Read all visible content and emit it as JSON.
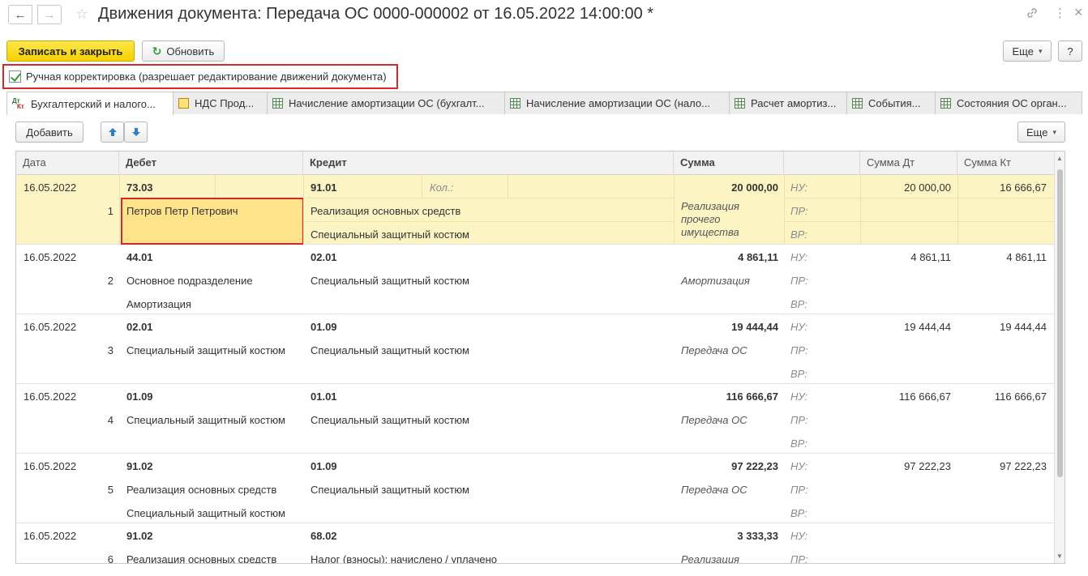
{
  "window": {
    "title": "Движения документа: Передача ОС 0000-000002 от 16.05.2022 14:00:00 *",
    "back_icon": "←",
    "forward_icon": "→",
    "star_icon": "☆",
    "link_icon": "🔗",
    "more_icon": "⋮",
    "close_icon": "×"
  },
  "toolbar": {
    "save_close_label": "Записать и закрыть",
    "refresh_label": "Обновить",
    "refresh_glyph": "↻",
    "more_label": "Еще",
    "help_label": "?"
  },
  "manual_edit": {
    "label": "Ручная корректировка (разрешает редактирование движений документа)",
    "checked": true
  },
  "tabs": [
    {
      "label": "Бухгалтерский и налого...",
      "icon": "dt-kt-icon",
      "active": true
    },
    {
      "label": "НДС Прод...",
      "icon": "nds-icon",
      "active": false
    },
    {
      "label": "Начисление амортизации ОС (бухгалт...",
      "icon": "grid-icon",
      "active": false
    },
    {
      "label": "Начисление амортизации ОС (нало...",
      "icon": "grid-icon",
      "active": false
    },
    {
      "label": "Расчет амортиз...",
      "icon": "grid-icon",
      "active": false
    },
    {
      "label": "События...",
      "icon": "grid-icon",
      "active": false
    },
    {
      "label": "Состояния ОС орган...",
      "icon": "grid-icon",
      "active": false
    }
  ],
  "dt_kt": {
    "dt": "Дт",
    "kt": "Кт"
  },
  "table_toolbar": {
    "add_label": "Добавить",
    "up_icon": "🡅",
    "down_icon": "🡇",
    "more_label": "Еще"
  },
  "columns": {
    "date": "Дата",
    "debit": "Дебет",
    "credit": "Кредит",
    "sum": "Сумма",
    "blank": "",
    "sum_dt": "Сумма Дт",
    "sum_kt": "Сумма Кт"
  },
  "labels": {
    "nu": "НУ:",
    "pr": "ПР:",
    "vr": "ВР:",
    "kol": "Кол.:"
  },
  "rows": [
    {
      "date": "16.05.2022",
      "num": "1",
      "debit_acc": "73.03",
      "debit_sub1": "Петров Петр Петрович",
      "debit_sub2": "",
      "credit_acc": "91.01",
      "credit_sub1": "Реализация основных средств",
      "credit_sub2": "Специальный защитный костюм",
      "sum": "20 000,00",
      "content": "Реализация прочего имущества",
      "sum_dt": "20 000,00",
      "sum_kt": "16 666,67"
    },
    {
      "date": "16.05.2022",
      "num": "2",
      "debit_acc": "44.01",
      "debit_sub1": "Основное подразделение",
      "debit_sub2": "Амортизация",
      "credit_acc": "02.01",
      "credit_sub1": "Специальный защитный костюм",
      "credit_sub2": "",
      "sum": "4 861,11",
      "content": "Амортизация",
      "sum_dt": "4 861,11",
      "sum_kt": "4 861,11"
    },
    {
      "date": "16.05.2022",
      "num": "3",
      "debit_acc": "02.01",
      "debit_sub1": "Специальный защитный костюм",
      "debit_sub2": "",
      "credit_acc": "01.09",
      "credit_sub1": "Специальный защитный костюм",
      "credit_sub2": "",
      "sum": "19 444,44",
      "content": "Передача ОС",
      "sum_dt": "19 444,44",
      "sum_kt": "19 444,44"
    },
    {
      "date": "16.05.2022",
      "num": "4",
      "debit_acc": "01.09",
      "debit_sub1": "Специальный защитный костюм",
      "debit_sub2": "",
      "credit_acc": "01.01",
      "credit_sub1": "Специальный защитный костюм",
      "credit_sub2": "",
      "sum": "116 666,67",
      "content": "Передача ОС",
      "sum_dt": "116 666,67",
      "sum_kt": "116 666,67"
    },
    {
      "date": "16.05.2022",
      "num": "5",
      "debit_acc": "91.02",
      "debit_sub1": "Реализация основных средств",
      "debit_sub2": "Специальный защитный костюм",
      "credit_acc": "01.09",
      "credit_sub1": "Специальный защитный костюм",
      "credit_sub2": "",
      "sum": "97 222,23",
      "content": "Передача ОС",
      "sum_dt": "97 222,23",
      "sum_kt": "97 222,23"
    },
    {
      "date": "16.05.2022",
      "num": "6",
      "debit_acc": "91.02",
      "debit_sub1": "Реализация основных средств",
      "debit_sub2": "",
      "credit_acc": "68.02",
      "credit_sub1": "Налог (взносы): начислено / уплачено",
      "credit_sub2": "",
      "sum": "3 333,33",
      "content": "Реализация",
      "sum_dt": "",
      "sum_kt": ""
    }
  ],
  "colors": {
    "accent_yellow": "#f5d100",
    "selected_row": "#fdf4c4",
    "selected_cell": "#ffe38a",
    "highlight_border": "#d62828"
  }
}
